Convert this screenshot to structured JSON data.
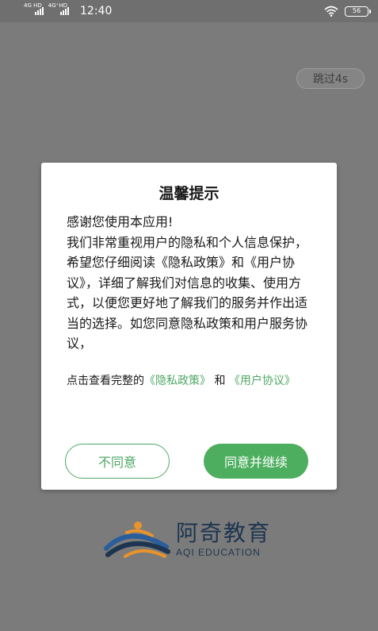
{
  "status_bar": {
    "network1": "4G HD",
    "network2": "4G⁺HD",
    "time": "12:40",
    "battery": "56"
  },
  "splash": {
    "skip_label": "跳过4s",
    "brand_cn": "阿奇教育",
    "brand_en": "AQI EDUCATION"
  },
  "dialog": {
    "title": "温馨提示",
    "line1": "感谢您使用本应用!",
    "body": "我们非常重视用户的隐私和个人信息保护，希望您仔细阅读《隐私政策》和《用户协议》，详细了解我们对信息的收集、使用方式，以便您更好地了解我们的服务并作出适当的选择。如您同意隐私政策和用户服务协议，",
    "links_prefix": "点击查看完整的",
    "privacy_link": "《隐私政策》",
    "conjunction": " 和 ",
    "agreement_link": "《用户协议》",
    "decline_label": "不同意",
    "accept_label": "同意并继续"
  },
  "colors": {
    "accent": "#4cae5e",
    "overlay": "#7b7b7b",
    "brand_navy": "#1d3550"
  }
}
